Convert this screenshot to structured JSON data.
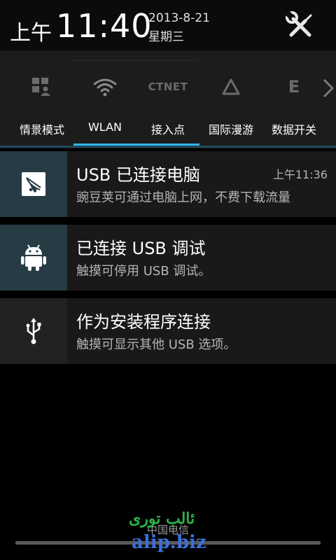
{
  "status": {
    "time_prefix": "上午",
    "time": "11:40",
    "date": "2013-8-21",
    "weekday": "星期三",
    "settings_icon": "tools-icon"
  },
  "toggles": [
    {
      "label": "情景模式",
      "icon": "profile-mode-icon",
      "active": false
    },
    {
      "label": "WLAN",
      "icon": "wifi-icon",
      "active": true
    },
    {
      "label": "接入点",
      "icon_text": "CTNET",
      "active": false
    },
    {
      "label": "国际漫游",
      "icon": "triangle-roaming-icon",
      "active": false
    },
    {
      "label": "数据开关",
      "icon_text": "E",
      "active": false
    }
  ],
  "notifications": [
    {
      "title": "USB 已连接电脑",
      "subtitle": "豌豆荚可通过电脑上网，不费下载流量",
      "time": "上午11:36",
      "icon": "wandoujia-icon"
    },
    {
      "title": "已连接 USB 调试",
      "subtitle": "触摸可停用 USB 调试。",
      "icon": "android-icon"
    },
    {
      "title": "作为安装程序连接",
      "subtitle": "触摸可显示其他 USB 选项。",
      "icon": "usb-icon"
    }
  ],
  "footer": {
    "carrier": "中国电信"
  },
  "watermark": {
    "arabic": "ئالب تورى",
    "site": "alip.biz"
  },
  "colors": {
    "accent": "#33b5e5",
    "icon_box_blue": "#263b44",
    "watermark_green": "#2db24a",
    "watermark_blue": "#3a70d9"
  }
}
